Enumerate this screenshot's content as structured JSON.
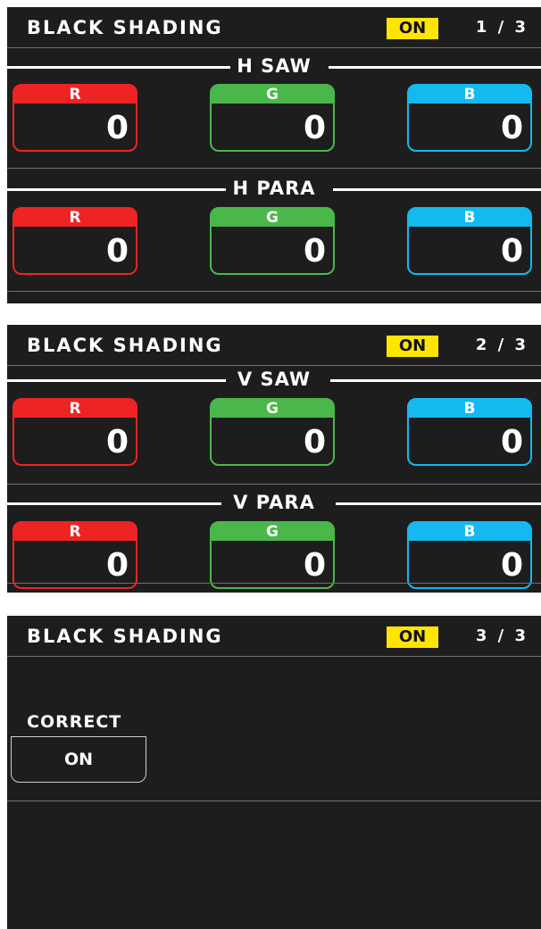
{
  "pages": [
    {
      "title": "BLACK SHADING",
      "status": "ON",
      "page": "1 / 3",
      "sections": [
        {
          "label": "H SAW",
          "cells": [
            {
              "channel": "R",
              "value": "0"
            },
            {
              "channel": "G",
              "value": "0"
            },
            {
              "channel": "B",
              "value": "0"
            }
          ]
        },
        {
          "label": "H PARA",
          "cells": [
            {
              "channel": "R",
              "value": "0"
            },
            {
              "channel": "G",
              "value": "0"
            },
            {
              "channel": "B",
              "value": "0"
            }
          ]
        }
      ]
    },
    {
      "title": "BLACK SHADING",
      "status": "ON",
      "page": "2 / 3",
      "sections": [
        {
          "label": "V SAW",
          "cells": [
            {
              "channel": "R",
              "value": "0"
            },
            {
              "channel": "G",
              "value": "0"
            },
            {
              "channel": "B",
              "value": "0"
            }
          ]
        },
        {
          "label": "V PARA",
          "cells": [
            {
              "channel": "R",
              "value": "0"
            },
            {
              "channel": "G",
              "value": "0"
            },
            {
              "channel": "B",
              "value": "0"
            }
          ]
        }
      ]
    },
    {
      "title": "BLACK SHADING",
      "status": "ON",
      "page": "3 / 3",
      "correct": {
        "label": "CORRECT",
        "value": "ON"
      }
    }
  ],
  "colors": {
    "r": "#ee2324",
    "g": "#4ab74b",
    "b": "#14b9ef",
    "status": "#ffe600",
    "panel": "#1d1d1d"
  }
}
